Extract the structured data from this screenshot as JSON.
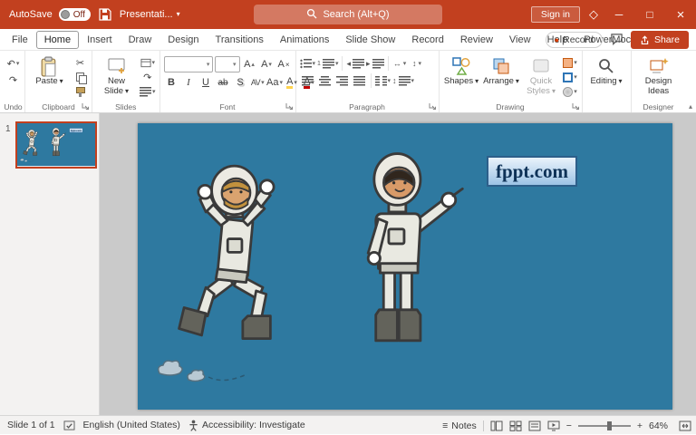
{
  "titlebar": {
    "autosave_label": "AutoSave",
    "autosave_state": "Off",
    "doc_title": "Presentati...",
    "search_placeholder": "Search (Alt+Q)",
    "sign_in_label": "Sign in"
  },
  "menubar": {
    "tabs": [
      "File",
      "Home",
      "Insert",
      "Draw",
      "Design",
      "Transitions",
      "Animations",
      "Slide Show",
      "Record",
      "Review",
      "View",
      "Help",
      "PowerMockup"
    ],
    "active_tab": "Home",
    "record_label": "Record",
    "share_label": "Share"
  },
  "ribbon": {
    "undo": {
      "label": "Undo"
    },
    "clipboard": {
      "label": "Clipboard",
      "paste": "Paste"
    },
    "slides": {
      "label": "Slides",
      "new_slide": "New Slide"
    },
    "font": {
      "label": "Font",
      "name_value": "",
      "size_value": "",
      "grow": "A",
      "shrink": "A",
      "clear": "A",
      "bold": "B",
      "italic": "I",
      "underline": "U",
      "strikethrough": "ab",
      "shadow": "S",
      "char_spacing": "AV",
      "change_case": "Aa",
      "highlight": "A",
      "font_color": "A"
    },
    "paragraph": {
      "label": "Paragraph"
    },
    "drawing": {
      "label": "Drawing",
      "shapes": "Shapes",
      "arrange": "Arrange",
      "quick_styles": "Quick Styles"
    },
    "editing": {
      "label": "Editing"
    },
    "designer": {
      "label": "Designer",
      "design_ideas": "Design Ideas"
    }
  },
  "slide_panel": {
    "slide_number": "1"
  },
  "slide": {
    "logo_text": "fppt.com"
  },
  "statusbar": {
    "slide_indicator": "Slide 1 of 1",
    "language": "English (United States)",
    "accessibility": "Accessibility: Investigate",
    "notes_label": "Notes",
    "zoom_level": "64%"
  },
  "icons": {
    "chevron_down": "▾",
    "chevron_up": "▴",
    "undo": "↶",
    "redo": "↷",
    "scissors": "✂",
    "minimize": "─",
    "maximize": "□",
    "close": "×",
    "diamond": "◇",
    "record_dot": "●",
    "notes": "≡",
    "zoom_out": "−",
    "zoom_in": "+",
    "grow": "▴",
    "shrink": "▾",
    "clear_x": "×",
    "updown": "↕",
    "leftright": "↔",
    "numbering_glyph": "1"
  },
  "colors": {
    "titlebar": "#C2401F",
    "share_button": "#C2401F",
    "record_dot": "#D83B01",
    "slide_background": "#2E79A0",
    "canvas_background": "#CACACA",
    "thumbnail_border": "#C2401F"
  }
}
